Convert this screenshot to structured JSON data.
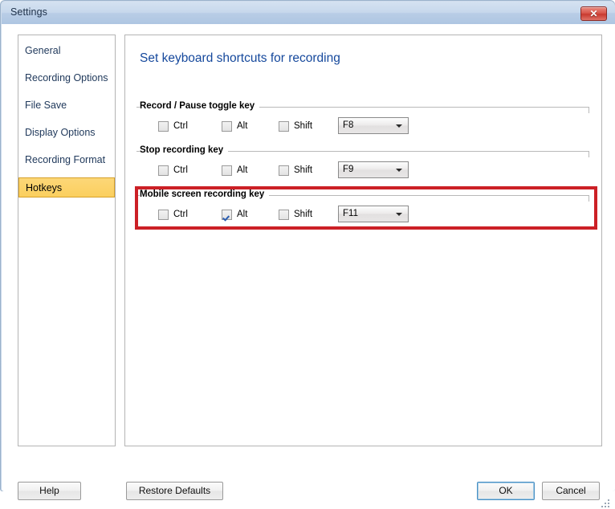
{
  "window": {
    "title": "Settings",
    "close_label": "✕",
    "accent_blue": "#15489c",
    "highlight_color": "#cc2026",
    "selected_item_color": "#fbcf5e"
  },
  "sidebar": {
    "items": [
      {
        "label": "General",
        "selected": false
      },
      {
        "label": "Recording Options",
        "selected": false
      },
      {
        "label": "File Save",
        "selected": false
      },
      {
        "label": "Display Options",
        "selected": false
      },
      {
        "label": "Recording Format",
        "selected": false
      },
      {
        "label": "Hotkeys",
        "selected": true
      }
    ]
  },
  "main": {
    "heading": "Set keyboard shortcuts for recording",
    "groups": [
      {
        "label": "Record / Pause toggle key",
        "highlighted": false,
        "modifiers": [
          {
            "label": "Ctrl",
            "checked": false
          },
          {
            "label": "Alt",
            "checked": false
          },
          {
            "label": "Shift",
            "checked": false
          }
        ],
        "key_select": {
          "value": "F8"
        }
      },
      {
        "label": "Stop recording key",
        "highlighted": false,
        "modifiers": [
          {
            "label": "Ctrl",
            "checked": false
          },
          {
            "label": "Alt",
            "checked": false
          },
          {
            "label": "Shift",
            "checked": false
          }
        ],
        "key_select": {
          "value": "F9"
        }
      },
      {
        "label": "Mobile screen recording key",
        "highlighted": true,
        "modifiers": [
          {
            "label": "Ctrl",
            "checked": false
          },
          {
            "label": "Alt",
            "checked": true
          },
          {
            "label": "Shift",
            "checked": false
          }
        ],
        "key_select": {
          "value": "F11"
        }
      }
    ]
  },
  "footer": {
    "help_label": "Help",
    "restore_label": "Restore Defaults",
    "ok_label": "OK",
    "cancel_label": "Cancel"
  }
}
